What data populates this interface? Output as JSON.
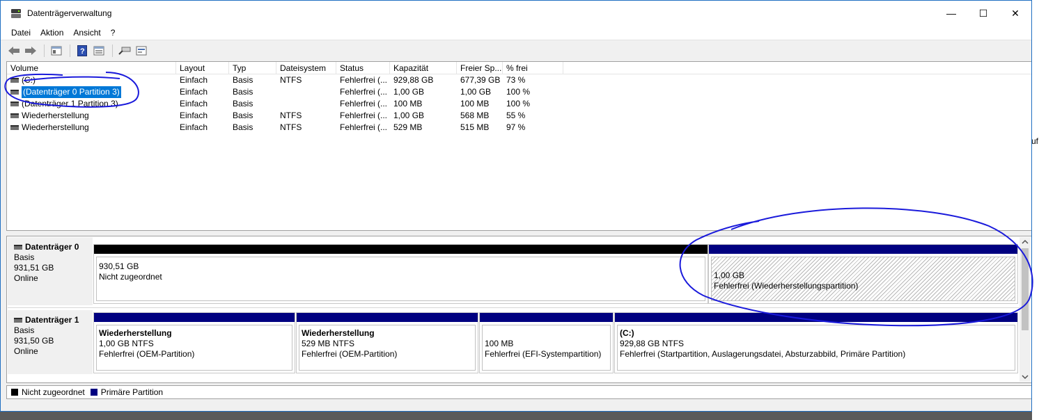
{
  "window": {
    "title": "Datenträgerverwaltung",
    "buttons": {
      "minimize": "—",
      "maximize": "☐",
      "close": "✕"
    }
  },
  "menu": [
    "Datei",
    "Aktion",
    "Ansicht",
    "?"
  ],
  "toolbar_icons": [
    "back-arrow-icon",
    "forward-arrow-icon",
    "properties-icon",
    "help-icon",
    "console-tree-icon",
    "rescan-icon",
    "settings-icon"
  ],
  "volume_table": {
    "columns": [
      "Volume",
      "Layout",
      "Typ",
      "Dateisystem",
      "Status",
      "Kapazität",
      "Freier Sp...",
      "% frei"
    ],
    "rows": [
      [
        "(C:)",
        "Einfach",
        "Basis",
        "NTFS",
        "Fehlerfrei (...",
        "929,88 GB",
        "677,39 GB",
        "73 %"
      ],
      [
        "(Datenträger 0 Partition 3)",
        "Einfach",
        "Basis",
        "",
        "Fehlerfrei (...",
        "1,00 GB",
        "1,00 GB",
        "100 %"
      ],
      [
        "(Datenträger 1 Partition 3)",
        "Einfach",
        "Basis",
        "",
        "Fehlerfrei (...",
        "100 MB",
        "100 MB",
        "100 %"
      ],
      [
        "Wiederherstellung",
        "Einfach",
        "Basis",
        "NTFS",
        "Fehlerfrei (...",
        "1,00 GB",
        "568 MB",
        "55 %"
      ],
      [
        "Wiederherstellung",
        "Einfach",
        "Basis",
        "NTFS",
        "Fehlerfrei (...",
        "529 MB",
        "515 MB",
        "97 %"
      ]
    ],
    "selected_row": 1
  },
  "disks": [
    {
      "name": "Datenträger 0",
      "type": "Basis",
      "size": "931,51 GB",
      "state": "Online",
      "partitions": [
        {
          "title": "",
          "line1": "930,51 GB",
          "line2": "Nicht zugeordnet",
          "bar_color": "#000000",
          "hatched": false
        },
        {
          "title": "",
          "line1": "1,00 GB",
          "line2": "Fehlerfrei (Wiederherstellungspartition)",
          "bar_color": "#000080",
          "hatched": true
        }
      ]
    },
    {
      "name": "Datenträger 1",
      "type": "Basis",
      "size": "931,50 GB",
      "state": "Online",
      "partitions": [
        {
          "title": "Wiederherstellung",
          "line1": "1,00 GB NTFS",
          "line2": "Fehlerfrei (OEM-Partition)",
          "bar_color": "#000080",
          "hatched": false
        },
        {
          "title": "Wiederherstellung",
          "line1": "529 MB NTFS",
          "line2": "Fehlerfrei (OEM-Partition)",
          "bar_color": "#000080",
          "hatched": false
        },
        {
          "title": "",
          "line1": "100 MB",
          "line2": "Fehlerfrei (EFI-Systempartition)",
          "bar_color": "#000080",
          "hatched": false
        },
        {
          "title": "(C:)",
          "line1": "929,88 GB NTFS",
          "line2": "Fehlerfrei (Startpartition, Auslagerungsdatei, Absturzabbild, Primäre Partition)",
          "bar_color": "#000080",
          "hatched": false
        }
      ]
    }
  ],
  "legend": [
    {
      "label": "Nicht zugeordnet",
      "color": "#000000"
    },
    {
      "label": "Primäre Partition",
      "color": "#000080"
    }
  ],
  "background_fragment": "uf",
  "colors": {
    "selection": "#0078d7",
    "primary_partition": "#000080",
    "unallocated": "#000000",
    "annotation_ink": "#1a1adb"
  }
}
